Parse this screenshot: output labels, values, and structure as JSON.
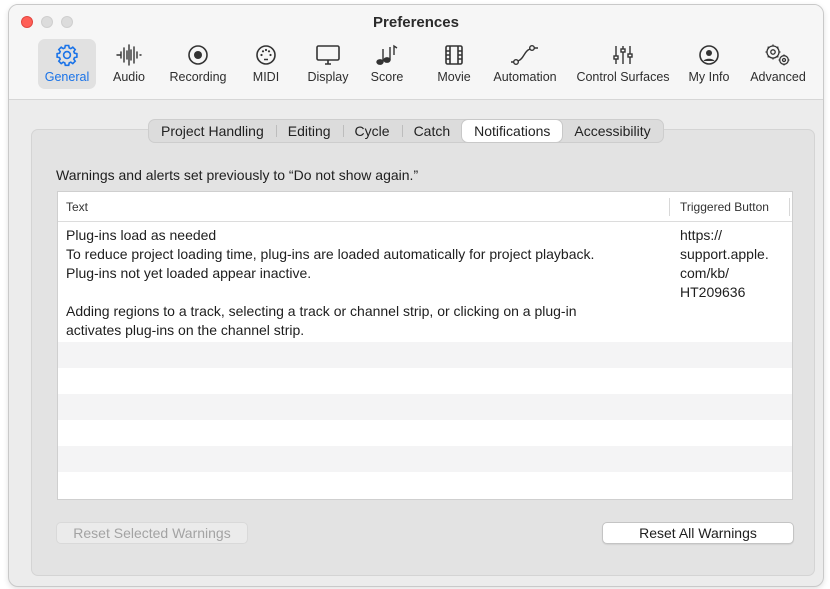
{
  "window": {
    "title": "Preferences"
  },
  "toolbar": {
    "tabs": [
      {
        "label": "General",
        "icon": "gear-icon",
        "active": true
      },
      {
        "label": "Audio",
        "icon": "waveform-icon",
        "active": false
      },
      {
        "label": "Recording",
        "icon": "record-icon",
        "active": false
      },
      {
        "label": "MIDI",
        "icon": "midi-icon",
        "active": false
      },
      {
        "label": "Display",
        "icon": "monitor-icon",
        "active": false
      },
      {
        "label": "Score",
        "icon": "music-notes-icon",
        "active": false
      },
      {
        "label": "Movie",
        "icon": "film-icon",
        "active": false
      },
      {
        "label": "Automation",
        "icon": "automation-curve-icon",
        "active": false
      },
      {
        "label": "Control Surfaces",
        "icon": "faders-icon",
        "active": false
      },
      {
        "label": "My Info",
        "icon": "person-icon",
        "active": false
      },
      {
        "label": "Advanced",
        "icon": "gears-icon",
        "active": false
      }
    ]
  },
  "subtabs": [
    {
      "label": "Project Handling",
      "active": false
    },
    {
      "label": "Editing",
      "active": false
    },
    {
      "label": "Cycle",
      "active": false
    },
    {
      "label": "Catch",
      "active": false
    },
    {
      "label": "Notifications",
      "active": true
    },
    {
      "label": "Accessibility",
      "active": false
    }
  ],
  "notifications": {
    "heading": "Warnings and alerts set previously to “Do not show again.”",
    "columns": {
      "text": "Text",
      "triggered_button": "Triggered Button"
    },
    "rows": [
      {
        "text_lines": [
          "Plug-ins load as needed",
          "To reduce project loading time, plug-ins are loaded automatically for project playback.",
          "Plug-ins not yet loaded appear inactive.",
          "",
          "Adding regions to a track, selecting a track or channel strip, or clicking on a plug-in",
          "activates plug-ins on the channel strip."
        ],
        "triggered_button_lines": [
          "https://",
          "support.apple.",
          "com/kb/",
          "HT209636"
        ]
      }
    ],
    "buttons": {
      "reset_selected": "Reset Selected Warnings",
      "reset_all": "Reset All Warnings"
    }
  },
  "colors": {
    "accent": "#1a73e8",
    "close": "#ff5f57",
    "disabled_text": "#a3a3a3"
  }
}
